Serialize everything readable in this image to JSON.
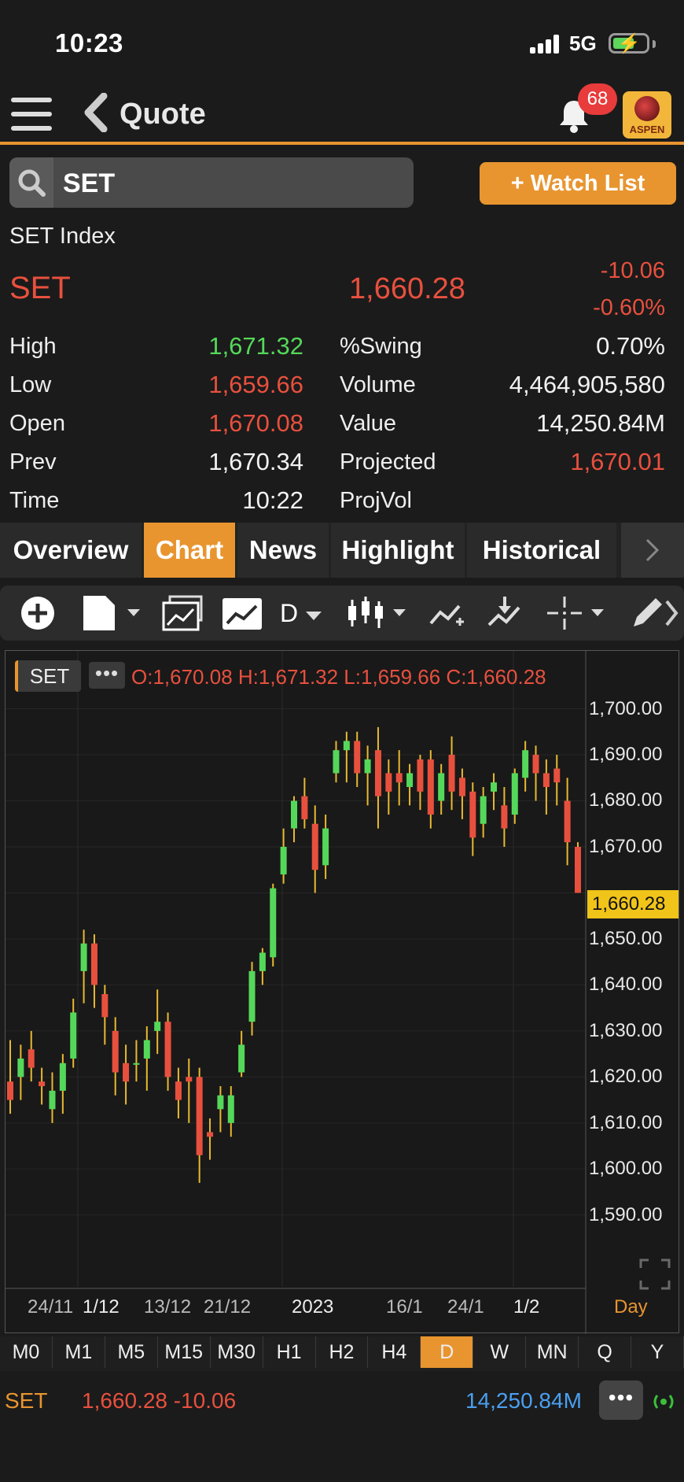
{
  "status": {
    "time": "10:23",
    "network": "5G"
  },
  "nav": {
    "title": "Quote",
    "notification_count": "68",
    "logo_text": "ASPEN"
  },
  "search": {
    "value": "SET"
  },
  "watchlist_label": "+ Watch List",
  "quote": {
    "index_name": "SET Index",
    "symbol": "SET",
    "last": "1,660.28",
    "change": "-10.06",
    "change_pct": "-0.60%",
    "left_stats": [
      {
        "label": "High",
        "value": "1,671.32",
        "color": "green"
      },
      {
        "label": "Low",
        "value": "1,659.66",
        "color": "red"
      },
      {
        "label": "Open",
        "value": "1,670.08",
        "color": "red"
      },
      {
        "label": "Prev",
        "value": "1,670.34",
        "color": "white"
      },
      {
        "label": "Time",
        "value": "10:22",
        "color": "white"
      }
    ],
    "right_stats": [
      {
        "label": "%Swing",
        "value": "0.70%",
        "color": "white"
      },
      {
        "label": "Volume",
        "value": "4,464,905,580",
        "color": "white"
      },
      {
        "label": "Value",
        "value": "14,250.84M",
        "color": "white"
      },
      {
        "label": "Projected",
        "value": "1,670.01",
        "color": "red"
      },
      {
        "label": "ProjVol",
        "value": "",
        "color": "white"
      }
    ]
  },
  "tabs": [
    "Overview",
    "Chart",
    "News",
    "Highlight",
    "Historical"
  ],
  "active_tab": "Chart",
  "toolbar": {
    "icons": [
      "add-icon",
      "document-icon",
      "compare-icon",
      "chart-icon",
      "period-dropdown",
      "candlestick-icon",
      "indicator-icon",
      "drawing-tools-icon",
      "crosshair-icon",
      "pencil-icon"
    ],
    "period": "D"
  },
  "chart": {
    "symbol_chip": "SET",
    "ohlc_text": "O:1,670.08 H:1,671.32 L:1,659.66 C:1,660.28",
    "last_tag": "1,660.28",
    "day_label": "Day",
    "y_ticks": [
      "1,700.00",
      "1,690.00",
      "1,680.00",
      "1,670.00",
      "1,650.00",
      "1,640.00",
      "1,630.00",
      "1,620.00",
      "1,610.00",
      "1,600.00",
      "1,590.00"
    ],
    "x_ticks": [
      "24/11",
      "1/12",
      "13/12",
      "21/12",
      "2023",
      "16/1",
      "24/1",
      "1/2"
    ]
  },
  "chart_data": {
    "type": "candlestick",
    "ylim": [
      1585,
      1703
    ],
    "up_color": "#55d85a",
    "down_color": "#e8503e",
    "candles": [
      {
        "o": 1619,
        "h": 1628,
        "l": 1612,
        "c": 1615
      },
      {
        "o": 1620,
        "h": 1627,
        "l": 1615,
        "c": 1624
      },
      {
        "o": 1626,
        "h": 1630,
        "l": 1619,
        "c": 1622
      },
      {
        "o": 1619,
        "h": 1622,
        "l": 1614,
        "c": 1618
      },
      {
        "o": 1613,
        "h": 1621,
        "l": 1610,
        "c": 1617
      },
      {
        "o": 1617,
        "h": 1625,
        "l": 1612,
        "c": 1623
      },
      {
        "o": 1624,
        "h": 1637,
        "l": 1622,
        "c": 1634
      },
      {
        "o": 1643,
        "h": 1652,
        "l": 1636,
        "c": 1649
      },
      {
        "o": 1649,
        "h": 1651,
        "l": 1635,
        "c": 1640
      },
      {
        "o": 1638,
        "h": 1640,
        "l": 1627,
        "c": 1633
      },
      {
        "o": 1630,
        "h": 1633,
        "l": 1616,
        "c": 1621
      },
      {
        "o": 1623,
        "h": 1627,
        "l": 1614,
        "c": 1619
      },
      {
        "o": 1623,
        "h": 1628,
        "l": 1619,
        "c": 1623
      },
      {
        "o": 1624,
        "h": 1631,
        "l": 1617,
        "c": 1628
      },
      {
        "o": 1630,
        "h": 1639,
        "l": 1625,
        "c": 1632
      },
      {
        "o": 1632,
        "h": 1634,
        "l": 1617,
        "c": 1620
      },
      {
        "o": 1619,
        "h": 1622,
        "l": 1611,
        "c": 1615
      },
      {
        "o": 1620,
        "h": 1624,
        "l": 1610,
        "c": 1619
      },
      {
        "o": 1620,
        "h": 1622,
        "l": 1597,
        "c": 1603
      },
      {
        "o": 1608,
        "h": 1611,
        "l": 1602,
        "c": 1607
      },
      {
        "o": 1613,
        "h": 1618,
        "l": 1608,
        "c": 1616
      },
      {
        "o": 1610,
        "h": 1618,
        "l": 1607,
        "c": 1616
      },
      {
        "o": 1621,
        "h": 1630,
        "l": 1620,
        "c": 1627
      },
      {
        "o": 1632,
        "h": 1645,
        "l": 1629,
        "c": 1643
      },
      {
        "o": 1643,
        "h": 1648,
        "l": 1640,
        "c": 1647
      },
      {
        "o": 1646,
        "h": 1662,
        "l": 1644,
        "c": 1661
      },
      {
        "o": 1664,
        "h": 1674,
        "l": 1662,
        "c": 1670
      },
      {
        "o": 1674,
        "h": 1681,
        "l": 1671,
        "c": 1680
      },
      {
        "o": 1681,
        "h": 1685,
        "l": 1674,
        "c": 1676
      },
      {
        "o": 1675,
        "h": 1679,
        "l": 1660,
        "c": 1665
      },
      {
        "o": 1666,
        "h": 1677,
        "l": 1663,
        "c": 1674
      },
      {
        "o": 1686,
        "h": 1693,
        "l": 1684,
        "c": 1691
      },
      {
        "o": 1691,
        "h": 1695,
        "l": 1684,
        "c": 1693
      },
      {
        "o": 1693,
        "h": 1695,
        "l": 1683,
        "c": 1686
      },
      {
        "o": 1686,
        "h": 1692,
        "l": 1679,
        "c": 1689
      },
      {
        "o": 1691,
        "h": 1696,
        "l": 1674,
        "c": 1681
      },
      {
        "o": 1686,
        "h": 1689,
        "l": 1677,
        "c": 1682
      },
      {
        "o": 1686,
        "h": 1691,
        "l": 1679,
        "c": 1684
      },
      {
        "o": 1683,
        "h": 1688,
        "l": 1679,
        "c": 1686
      },
      {
        "o": 1689,
        "h": 1690,
        "l": 1678,
        "c": 1682
      },
      {
        "o": 1689,
        "h": 1691,
        "l": 1674,
        "c": 1677
      },
      {
        "o": 1680,
        "h": 1688,
        "l": 1677,
        "c": 1686
      },
      {
        "o": 1690,
        "h": 1694,
        "l": 1678,
        "c": 1682
      },
      {
        "o": 1685,
        "h": 1687,
        "l": 1676,
        "c": 1681
      },
      {
        "o": 1682,
        "h": 1684,
        "l": 1668,
        "c": 1672
      },
      {
        "o": 1675,
        "h": 1683,
        "l": 1672,
        "c": 1681
      },
      {
        "o": 1682,
        "h": 1686,
        "l": 1678,
        "c": 1684
      },
      {
        "o": 1679,
        "h": 1683,
        "l": 1670,
        "c": 1674
      },
      {
        "o": 1677,
        "h": 1687,
        "l": 1675,
        "c": 1686
      },
      {
        "o": 1685,
        "h": 1693,
        "l": 1682,
        "c": 1691
      },
      {
        "o": 1690,
        "h": 1692,
        "l": 1680,
        "c": 1686
      },
      {
        "o": 1686,
        "h": 1689,
        "l": 1677,
        "c": 1683
      },
      {
        "o": 1687,
        "h": 1690,
        "l": 1679,
        "c": 1684
      },
      {
        "o": 1680,
        "h": 1685,
        "l": 1666,
        "c": 1671
      },
      {
        "o": 1670,
        "h": 1671,
        "l": 1660,
        "c": 1660
      }
    ]
  },
  "timeframes": [
    "M0",
    "M1",
    "M5",
    "M15",
    "M30",
    "H1",
    "H2",
    "H4",
    "D",
    "W",
    "MN",
    "Q",
    "Y"
  ],
  "active_timeframe": "D",
  "bottom": {
    "symbol": "SET",
    "price_change": "1,660.28 -10.06",
    "value": "14,250.84M",
    "more": "•••"
  }
}
